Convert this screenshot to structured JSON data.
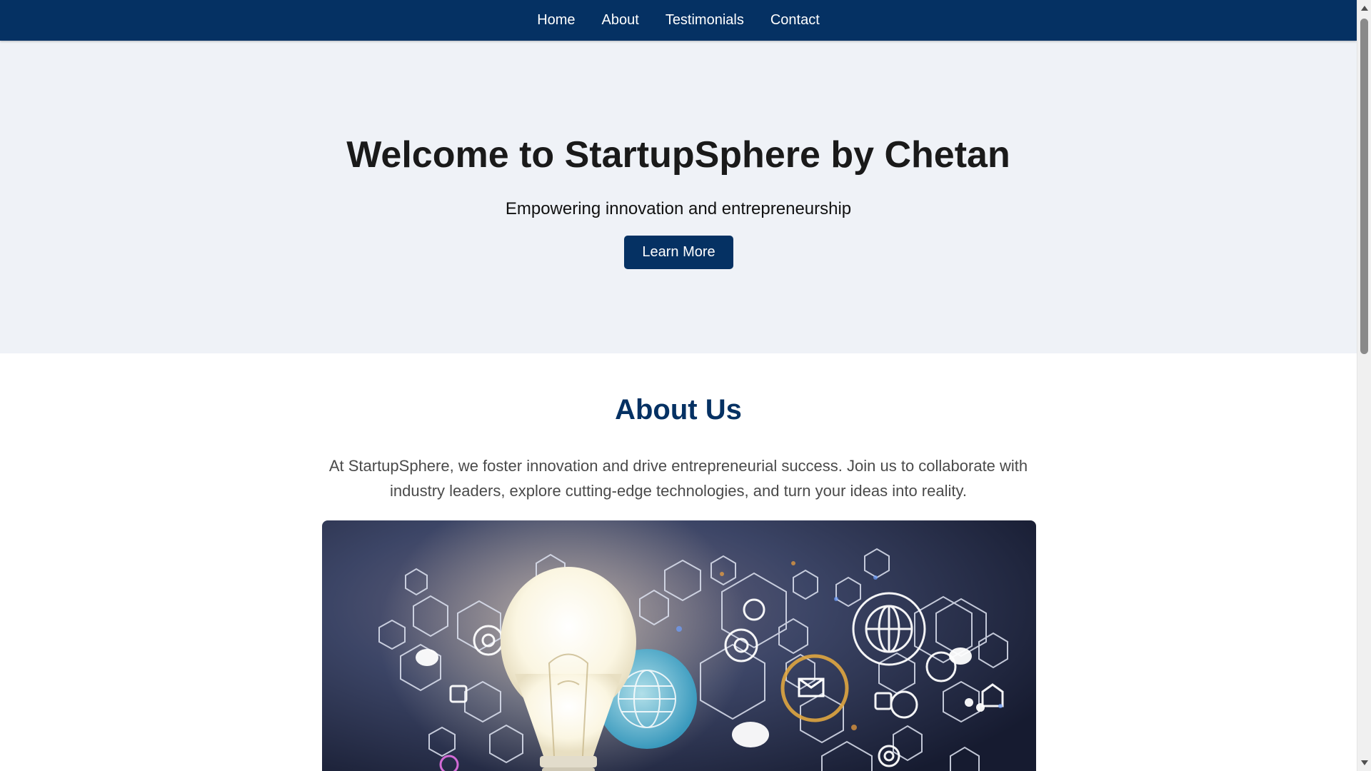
{
  "nav": {
    "items": [
      {
        "label": "Home"
      },
      {
        "label": "About"
      },
      {
        "label": "Testimonials"
      },
      {
        "label": "Contact"
      }
    ]
  },
  "hero": {
    "title": "Welcome to StartupSphere by Chetan",
    "subtitle": "Empowering innovation and entrepreneurship",
    "button_label": "Learn More"
  },
  "about": {
    "title": "About Us",
    "text": "At StartupSphere, we foster innovation and drive entrepreneurial success. Join us to collaborate with industry leaders, explore cutting-edge technologies, and turn your ideas into reality.",
    "image_icon": "lightbulb-innovation-illustration"
  },
  "colors": {
    "brand": "#053163",
    "hero_bg": "#eff2f7",
    "text": "#1a1a1a",
    "body_text": "#4a4a4a"
  }
}
